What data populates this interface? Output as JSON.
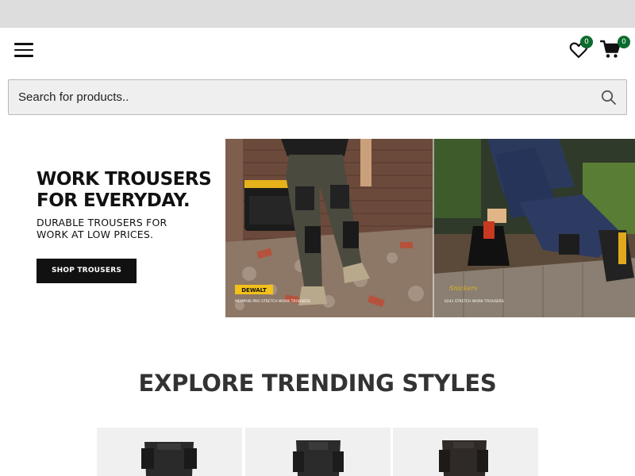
{
  "header": {
    "menu_icon": "hamburger-menu-icon",
    "wishlist": {
      "icon": "heart-icon",
      "count": "0"
    },
    "cart": {
      "icon": "shopping-cart-icon",
      "count": "0"
    }
  },
  "search": {
    "placeholder": "Search for products..",
    "icon": "search-icon"
  },
  "hero": {
    "title_line1": "WORK TROUSERS",
    "title_line2": "FOR EVERYDAY.",
    "subtitle_line1": "DURABLE TROUSERS FOR",
    "subtitle_line2": "WORK AT LOW PRICES.",
    "button_label": "SHOP TROUSERS",
    "image_left_brand": "DEWALT",
    "image_left_caption": "MEMPHIS PRO STRETCH WORK TROUSERS",
    "image_right_brand": "Snickers",
    "image_right_caption": "6241 STRETCH WORK TROUSERS"
  },
  "trending": {
    "title": "EXPLORE TRENDING STYLES",
    "products": [
      {
        "name": "work-trousers"
      },
      {
        "name": "work-trousers"
      },
      {
        "name": "work-trousers"
      }
    ]
  },
  "colors": {
    "badge": "#0a6b2d",
    "button": "#111111",
    "topbar": "#dddddd"
  }
}
